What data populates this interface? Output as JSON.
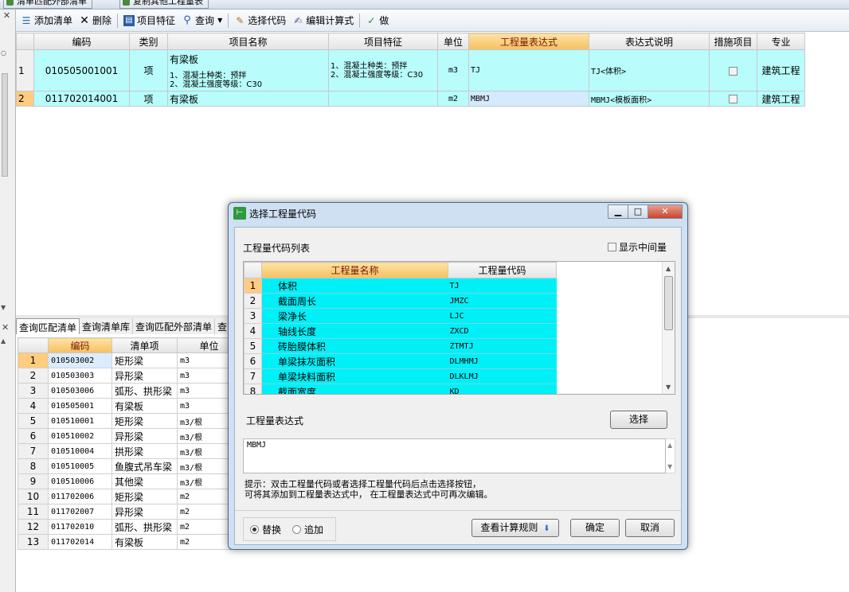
{
  "tabs": [
    {
      "label": "清单匹配外部清单"
    },
    {
      "label": "复制其他工程量表"
    }
  ],
  "toolbar": {
    "add_list": "添加清单",
    "delete": "删除",
    "item_feature": "项目特征",
    "query": "查询",
    "select_code": "选择代码",
    "edit_formula": "编辑计算式",
    "do": "做"
  },
  "top_grid": {
    "headers": [
      "编码",
      "类别",
      "项目名称",
      "项目特征",
      "单位",
      "工程量表达式",
      "表达式说明",
      "措施项目",
      "专业"
    ],
    "rows": [
      {
        "num": "1",
        "code": "010505001001",
        "category": "项",
        "name_line1": "有梁板",
        "name_line2": "1、混凝土种类：预拌",
        "name_line3": "2、混凝土强度等级：C30",
        "feature_line1": "1、混凝土种类：预拌",
        "feature_line2": "2、混凝土强度等级：C30",
        "unit": "m3",
        "expr": "TJ",
        "expr_desc": "TJ<体积>",
        "measure": false,
        "specialty": "建筑工程"
      },
      {
        "num": "2",
        "code": "011702014001",
        "category": "项",
        "name_line1": "有梁板",
        "unit": "m2",
        "expr": "MBMJ",
        "expr_desc": "MBMJ<模板面积>",
        "measure": false,
        "specialty": "建筑工程"
      }
    ]
  },
  "bottom_tabs": [
    "查询匹配清单",
    "查询清单库",
    "查询匹配外部清单",
    "查"
  ],
  "bottom_grid": {
    "headers": [
      "编码",
      "清单项",
      "单位"
    ],
    "rows": [
      {
        "num": "1",
        "code": "010503002",
        "item": "矩形梁",
        "unit": "m3"
      },
      {
        "num": "2",
        "code": "010503003",
        "item": "异形梁",
        "unit": "m3"
      },
      {
        "num": "3",
        "code": "010503006",
        "item": "弧形、拱形梁",
        "unit": "m3"
      },
      {
        "num": "4",
        "code": "010505001",
        "item": "有梁板",
        "unit": "m3"
      },
      {
        "num": "5",
        "code": "010510001",
        "item": "矩形梁",
        "unit": "m3/根"
      },
      {
        "num": "6",
        "code": "010510002",
        "item": "异形梁",
        "unit": "m3/根"
      },
      {
        "num": "7",
        "code": "010510004",
        "item": "拱形梁",
        "unit": "m3/根"
      },
      {
        "num": "8",
        "code": "010510005",
        "item": "鱼腹式吊车梁",
        "unit": "m3/根"
      },
      {
        "num": "9",
        "code": "010510006",
        "item": "其他梁",
        "unit": "m3/根"
      },
      {
        "num": "10",
        "code": "011702006",
        "item": "矩形梁",
        "unit": "m2"
      },
      {
        "num": "11",
        "code": "011702007",
        "item": "异形梁",
        "unit": "m2"
      },
      {
        "num": "12",
        "code": "011702010",
        "item": "弧形、拱形梁",
        "unit": "m2"
      },
      {
        "num": "13",
        "code": "011702014",
        "item": "有梁板",
        "unit": "m2"
      }
    ]
  },
  "dialog": {
    "title": "选择工程量代码",
    "list_label": "工程量代码列表",
    "show_intermediate": "显示中间量",
    "grid_headers": [
      "工程量名称",
      "工程量代码"
    ],
    "codes": [
      {
        "num": "1",
        "name": "体积",
        "code": "TJ"
      },
      {
        "num": "2",
        "name": "截面周长",
        "code": "JMZC"
      },
      {
        "num": "3",
        "name": "梁净长",
        "code": "LJC"
      },
      {
        "num": "4",
        "name": "轴线长度",
        "code": "ZXCD"
      },
      {
        "num": "5",
        "name": "砖胎膜体积",
        "code": "ZTMTJ"
      },
      {
        "num": "6",
        "name": "单梁抹灰面积",
        "code": "DLMHMJ"
      },
      {
        "num": "7",
        "name": "单梁块料面积",
        "code": "DLKLMJ"
      },
      {
        "num": "8",
        "name": "截面宽度",
        "code": "KD"
      }
    ],
    "expr_label": "工程量表达式",
    "select_button": "选择",
    "expr_value": "MBMJ",
    "hint_line1": "提示：双击工程量代码或者选择工程量代码后点击选择按钮，",
    "hint_line2": "可将其添加到工程量表达式中， 在工程量表达式中可再次编辑。",
    "radio_replace": "替换",
    "radio_append": "追加",
    "view_rules_button": "查看计算规则",
    "ok_button": "确定",
    "cancel_button": "取消"
  }
}
